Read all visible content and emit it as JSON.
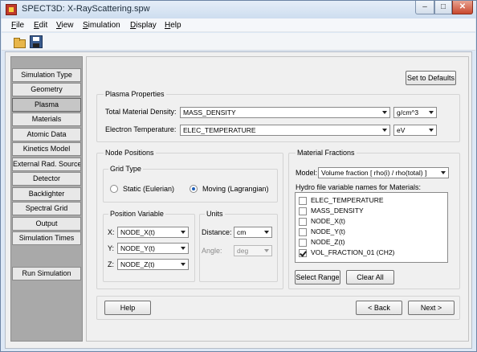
{
  "window": {
    "title": "SPECT3D:  X-RayScattering.spw"
  },
  "menu": [
    {
      "label": "File",
      "key": "F",
      "rest": "ile"
    },
    {
      "label": "Edit",
      "key": "E",
      "rest": "dit"
    },
    {
      "label": "View",
      "key": "V",
      "rest": "iew"
    },
    {
      "label": "Simulation",
      "key": "S",
      "rest": "imulation"
    },
    {
      "label": "Display",
      "key": "D",
      "rest": "isplay"
    },
    {
      "label": "Help",
      "key": "H",
      "rest": "elp"
    }
  ],
  "sidebar": {
    "items": [
      {
        "label": "Simulation Type"
      },
      {
        "label": "Geometry"
      },
      {
        "label": "Plasma"
      },
      {
        "label": "Materials"
      },
      {
        "label": "Atomic Data"
      },
      {
        "label": "Kinetics Model"
      },
      {
        "label": "External Rad. Source"
      },
      {
        "label": "Detector"
      },
      {
        "label": "Backlighter"
      },
      {
        "label": "Spectral Grid"
      },
      {
        "label": "Output"
      },
      {
        "label": "Simulation Times"
      }
    ],
    "active": "Plasma",
    "run_label": "Run Simulation"
  },
  "main": {
    "set_defaults_label": "Set to Defaults",
    "plasma_properties": {
      "title": "Plasma Properties",
      "density_label": "Total Material Density:",
      "density_value": "MASS_DENSITY",
      "density_unit": "g/cm^3",
      "temp_label": "Electron Temperature:",
      "temp_value": "ELEC_TEMPERATURE",
      "temp_unit": "eV"
    },
    "node_positions": {
      "title": "Node Positions",
      "grid_type_title": "Grid Type",
      "static_label": "Static (Eulerian)",
      "moving_label": "Moving (Lagrangian)",
      "selected": "Moving (Lagrangian)",
      "position_variable_title": "Position Variable",
      "x_label": "X:",
      "x_value": "NODE_X(t)",
      "y_label": "Y:",
      "y_value": "NODE_Y(t)",
      "z_label": "Z:",
      "z_value": "NODE_Z(t)",
      "units_title": "Units",
      "distance_label": "Distance:",
      "distance_value": "cm",
      "angle_label": "Angle:",
      "angle_value": "deg"
    },
    "material_fractions": {
      "title": "Material Fractions",
      "model_label": "Model:",
      "model_value": "Volume fraction [ rho(i) / rho(total) ]",
      "list_label": "Hydro file variable names for Materials:",
      "items": [
        {
          "label": "ELEC_TEMPERATURE",
          "checked": false
        },
        {
          "label": "MASS_DENSITY",
          "checked": false
        },
        {
          "label": "NODE_X(t)",
          "checked": false
        },
        {
          "label": "NODE_Y(t)",
          "checked": false
        },
        {
          "label": "NODE_Z(t)",
          "checked": false
        },
        {
          "label": "VOL_FRACTION_01 (CH2)",
          "checked": true
        }
      ],
      "select_range_label": "Select Range",
      "clear_all_label": "Clear All"
    },
    "nav": {
      "help_label": "Help",
      "back_label": "< Back",
      "next_label": "Next >"
    }
  }
}
